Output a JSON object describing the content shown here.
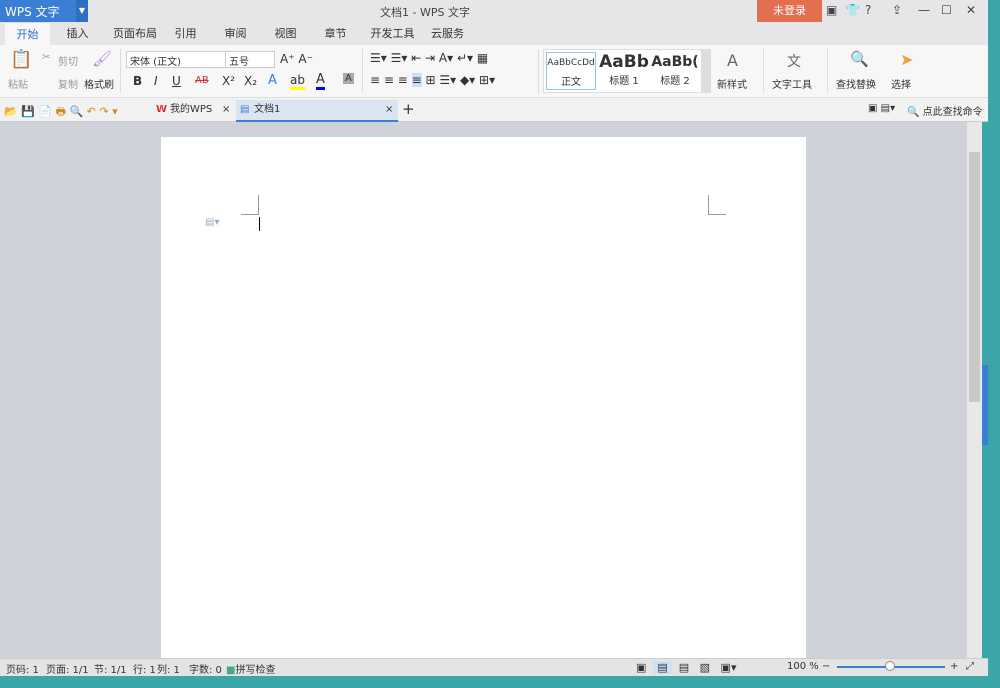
{
  "app": {
    "name": "WPS 文字",
    "title": "文档1 - WPS 文字",
    "login": "未登录",
    "help": "?"
  },
  "menu_tabs": [
    "开始",
    "插入",
    "页面布局",
    "引用",
    "审阅",
    "视图",
    "章节",
    "开发工具",
    "云服务"
  ],
  "ribbon": {
    "paste": "粘贴",
    "cut": "剪切",
    "copy": "复制",
    "format_painter": "格式刷",
    "font": "宋体 (正文)",
    "size": "五号",
    "bold": "B",
    "italic": "I",
    "underline": "U",
    "strike": "AB",
    "sup": "X²",
    "sub": "X₂",
    "styles": [
      {
        "preview": "AaBbCcDd",
        "label": "正文"
      },
      {
        "preview": "AaBb",
        "label": "标题 1"
      },
      {
        "preview": "AaBb(",
        "label": "标题 2"
      }
    ],
    "new_style": "新样式",
    "text_tools": "文字工具",
    "find_replace": "查找替换",
    "select": "选择"
  },
  "quickbar": {
    "doc_tabs": [
      {
        "label": "我的WPS"
      },
      {
        "label": "文档1"
      }
    ],
    "search": "点此查找命令"
  },
  "status": {
    "page": "页码: 1",
    "pages": "页面: 1/1",
    "section": "节: 1/1",
    "row": "行: 1",
    "col": "列: 1",
    "words": "字数: 0",
    "spell": "拼写检查",
    "zoom": "100 %",
    "zoom_value": 100
  }
}
